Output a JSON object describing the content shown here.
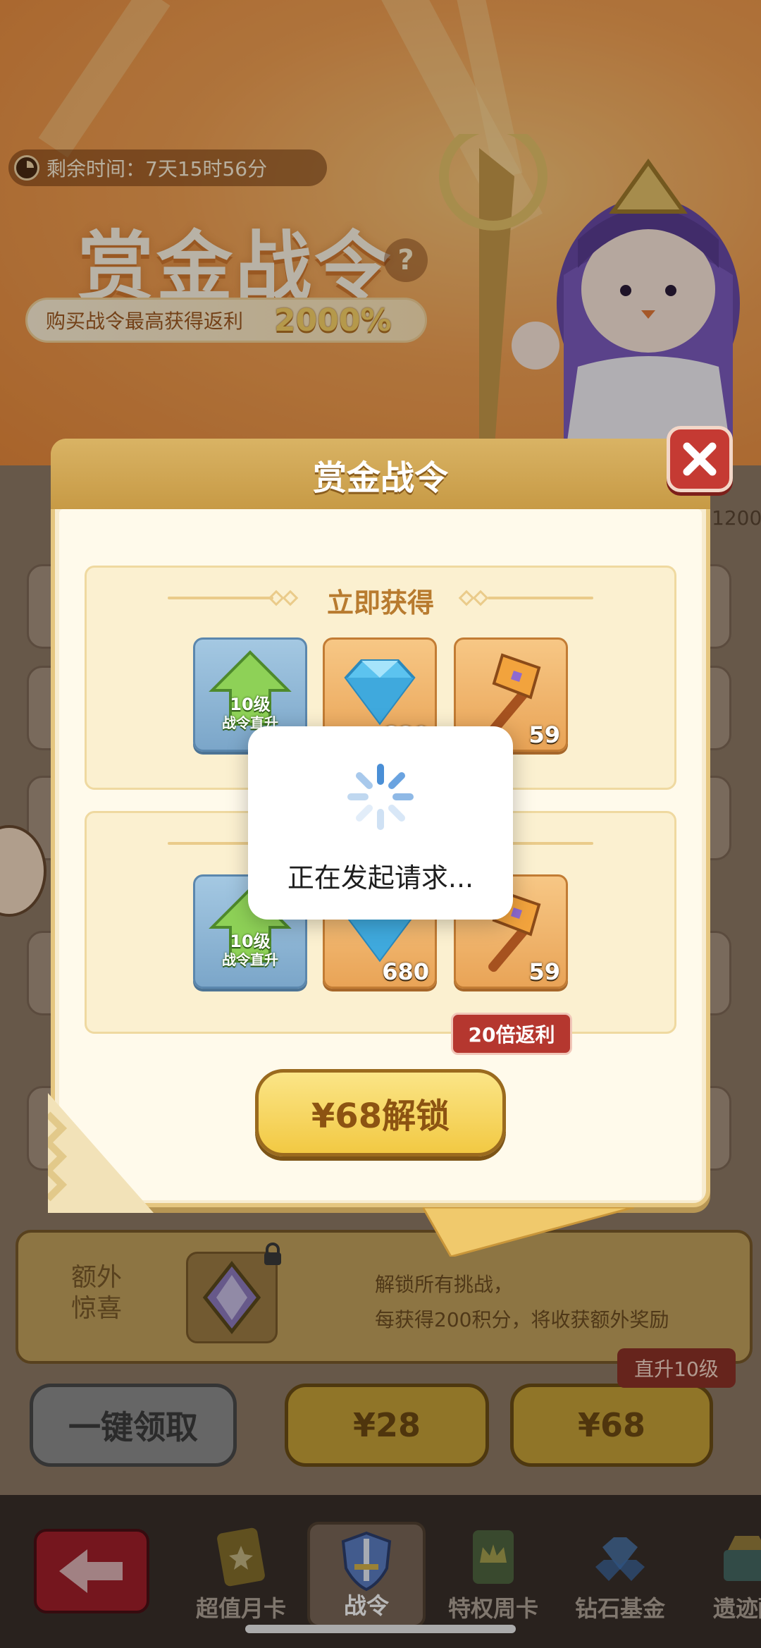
{
  "banner": {
    "timer_label": "剩余时间：7天15时56分",
    "title": "赏金战令",
    "help_icon": "question-icon",
    "help_glyph": "?",
    "rebate_text": "购买战令最高获得返利",
    "rebate_percent": "2000%",
    "side_number": "1200"
  },
  "modal": {
    "title": "赏金战令",
    "close_icon": "close-icon",
    "instant_section_title": "立即获得",
    "instant_items": [
      {
        "icon": "level-up-arrow-icon",
        "level": "10级",
        "caption": "战令直升",
        "qty": ""
      },
      {
        "icon": "diamond-icon",
        "qty": "680"
      },
      {
        "icon": "hammer-icon",
        "qty": "59"
      }
    ],
    "second_items": [
      {
        "icon": "level-up-arrow-icon",
        "level": "10级",
        "caption": "战令直升",
        "qty": ""
      },
      {
        "icon": "diamond-icon",
        "qty": "680"
      },
      {
        "icon": "hammer-icon",
        "qty": "59"
      }
    ],
    "rebate_tag": "20倍返利",
    "unlock_button": "¥68解锁"
  },
  "loading": {
    "text": "正在发起请求..."
  },
  "extra": {
    "title": "额外惊喜",
    "desc_line1": "解锁所有挑战，",
    "desc_line2": "每获得200积分，将收获额外奖励"
  },
  "actions": {
    "claim_all": "一键领取",
    "buy_28": "¥28",
    "buy_68": "¥68",
    "level_tag": "直升10级"
  },
  "nav": {
    "back_icon": "back-arrow-icon",
    "items": [
      {
        "label": "超值月卡",
        "icon": "card-icon"
      },
      {
        "label": "战令",
        "icon": "shield-sword-icon"
      },
      {
        "label": "特权周卡",
        "icon": "crown-card-icon"
      },
      {
        "label": "钻石基金",
        "icon": "diamond-pile-icon"
      },
      {
        "label": "遗迹酬",
        "icon": "chest-icon"
      }
    ]
  },
  "colors": {
    "accent_gold": "#f2c943",
    "danger_red": "#c53a33",
    "banner_orange": "#f3a153"
  }
}
